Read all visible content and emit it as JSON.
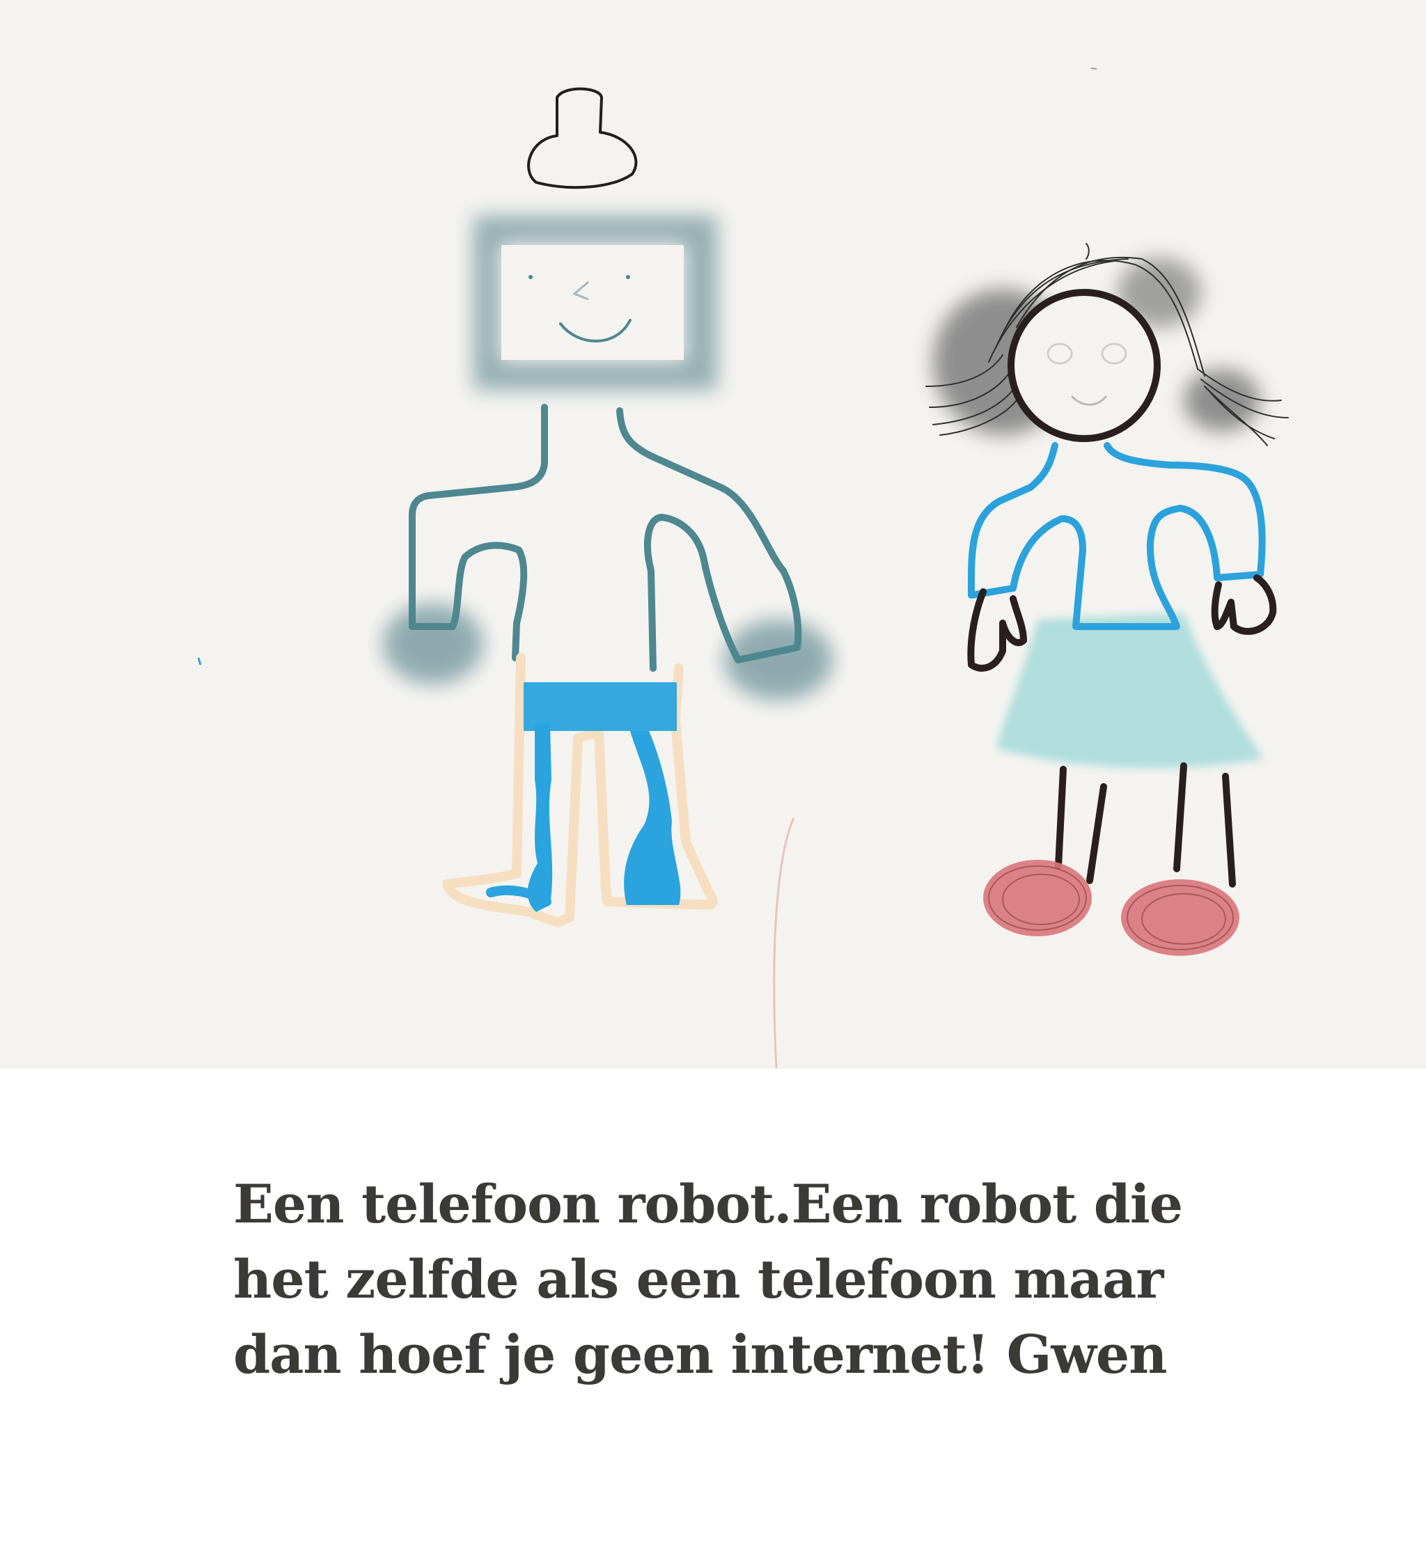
{
  "caption": {
    "text": "Een telefoon robot.Een robot die het zelfde als een telefoon maar dan hoef je geen internet! Gwen"
  },
  "colors": {
    "canvas_background": "#f4f3f0",
    "page_background": "#ffffff",
    "caption_text": "#3b3a37",
    "robot_outline": "#4e8790",
    "robot_blur": "#8aa7ac",
    "robot_pants": "#2aa3de",
    "girl_shirt": "#2ba2dc",
    "girl_skirt": "#a8dcda",
    "girl_outline": "#2a1f1f",
    "girl_shoes": "#d9757a",
    "girl_hair": "#3a3a3a"
  }
}
